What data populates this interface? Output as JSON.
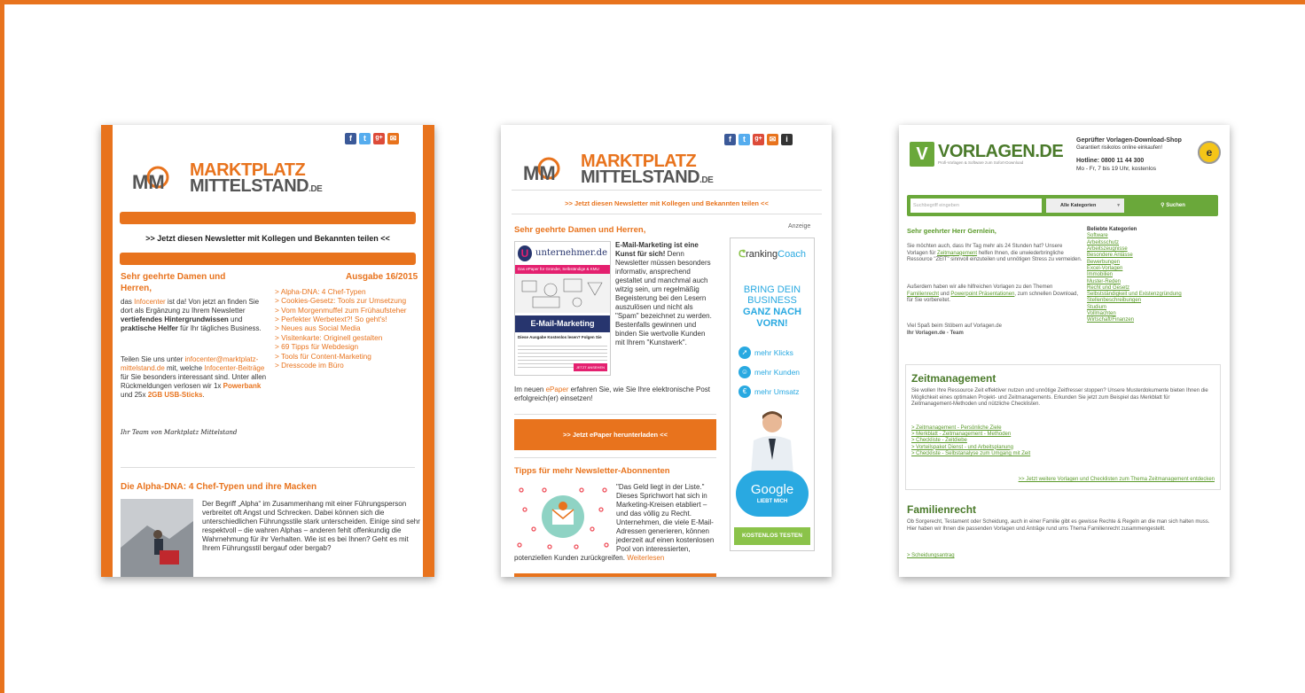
{
  "colors": {
    "accent": "#e8731d",
    "vorlagen_green": "#6aa83a",
    "facebook": "#3b5998",
    "twitter": "#55acee",
    "google": "#dd4b39",
    "mail": "#e8731d"
  },
  "card1": {
    "social_icons": [
      "facebook-icon",
      "twitter-icon",
      "googleplus-icon",
      "mail-icon"
    ],
    "logo_line1": "MARKTPLATZ",
    "logo_line2": "MITTELSTAND",
    "logo_suffix": ".DE",
    "share_text": ">> Jetzt diesen Newsletter mit Kollegen und Bekannten teilen <<",
    "greeting": "Sehr geehrte Damen und Herren,",
    "issue": "Ausgabe 16/2015",
    "intro_parts": [
      "das ",
      "Infocenter",
      " ist da! Von jetzt an finden Sie dort als Ergänzung zu Ihrem Newsletter ",
      "vertiefendes Hintergrundwissen",
      " und ",
      "praktische Helfer",
      " für Ihr tägliches Business."
    ],
    "share_parts": [
      "Teilen Sie uns unter ",
      "infocenter@marktplatz-mittelstand.de",
      " mit, welche ",
      "Infocenter-Beiträge",
      " für Sie besonders interessant sind. Unter allen Rückmeldungen verlosen wir 1x ",
      "Powerbank",
      " und 25x ",
      "2GB USB-Sticks",
      "."
    ],
    "toc": [
      "> Alpha-DNA: 4 Chef-Typen",
      "> Cookies-Gesetz: Tools zur Umsetzung",
      "> Vom Morgenmuffel zum Frühaufsteher",
      "> Perfekter Werbetext?! So geht's!",
      "> Neues aus Social Media",
      "> Visitenkarte: Originell gestalten",
      "> 69 Tipps für Webdesign",
      "> Tools für Content-Marketing",
      "> Dresscode im Büro"
    ],
    "signature": "Ihr Team von Marktplatz Mittelstand",
    "article_title": "Die Alpha-DNA: 4 Chef-Typen und ihre Macken",
    "article_text": "Der Begriff „Alpha“ im Zusammenhang mit einer Führungsperson verbreitet oft Angst und Schrecken. Dabei können sich die unterschiedlichen Führungsstile stark unterscheiden. Einige sind sehr respektvoll – die wahren Alphas – anderen fehlt offenkundig die Wahrnehmung für ihr Verhalten. Wie ist es bei Ihnen? Geht es mit Ihrem Führungsstil bergauf oder bergab?"
  },
  "card2": {
    "social_icons": [
      "facebook-icon",
      "twitter-icon",
      "googleplus-icon",
      "mail-icon",
      "info-icon"
    ],
    "share_text": ">> Jetzt diesen Newsletter mit Kollegen und Bekannten teilen <<",
    "greeting": "Sehr geehrte Damen und Herren,",
    "ad_label": "Anzeige",
    "epaper_brand": "unternehmer.de",
    "epaper_tagline": "Das ePaper für Gründer, Selbständige & KMU",
    "epaper_banner": "E-Mail-Marketing",
    "epaper_subtitle": "Diese Ausgabe Kostenlos lesen? Folgen Sie",
    "epaper_button": "JETZT ANSEHEN",
    "body_bold": "E-Mail-Marketing ist eine Kunst für sich!",
    "body_text": " Denn Newsletter müssen besonders informativ, ansprechend gestaltet und manchmal auch witzig sein, um regelmäßig Begeisterung bei den Lesern auszulösen und nicht als \"Spam\" bezeichnet zu werden. Bestenfalls gewinnen und binden Sie wertvolle Kunden mit Ihrem \"Kunstwerk\".",
    "epaper_parts": [
      "Im neuen ",
      "ePaper",
      " erfahren Sie, wie Sie Ihre elektronische Post erfolgreich(er) einsetzen!"
    ],
    "cta": ">> Jetzt ePaper herunterladen <<",
    "tips_title": "Tipps für mehr Newsletter-Abonnenten",
    "tips_text": "\"Das Geld liegt in der Liste.\" Dieses Sprichwort hat sich in Marketing-Kreisen etabliert – und das völlig zu Recht. Unternehmen, die viele E-Mail-Adressen generieren, können jederzeit auf einen kostenlosen Pool von interessierten, potenziellen Kunden zurückgreifen.",
    "read_more": "Weiterlesen",
    "ad": {
      "brand_a": "ranking",
      "brand_b": "Coach",
      "headline1": "BRING DEIN",
      "headline2": "BUSINESS",
      "headline3": "GANZ NACH",
      "headline4": "VORN!",
      "items": [
        "mehr Klicks",
        "mehr Kunden",
        "mehr Umsatz"
      ],
      "cloud_word": "Google",
      "cloud_sub": "LIEBT MICH",
      "button": "KOSTENLOS TESTEN"
    }
  },
  "card3": {
    "logo": "VORLAGEN.DE",
    "logo_sub": "Profi-Vorlagen & Software zum Sofort-Download",
    "shop_title": "Geprüfter Vorlagen-Download-Shop",
    "shop_sub": "Garantiert risikolos online einkaufen!",
    "hotline": "Hotline: 0800 11 44 300",
    "hours": "Mo - Fr, 7 bis 19 Uhr, kostenlos",
    "search_placeholder": "Suchbegriff eingeben",
    "category_select": "Alle Kategorien",
    "search_button": "Suchen",
    "greeting": "Sehr geehrter Herr Gernlein,",
    "p1_parts": [
      "Sie möchten auch, dass Ihr Tag mehr als 24 Stunden hat? Unsere Vorlagen für ",
      "Zeitmanagement",
      " helfen Ihnen, die unwiederbringliche Ressource \"ZEIT\" sinnvoll einzuteilen und unnötigen Stress zu vermeiden."
    ],
    "p2_parts": [
      "Außerdem haben wir alle hilfreichen Vorlagen zu den Themen ",
      "Familienrecht",
      " und ",
      "Powerpoint Präsentationen",
      ", zum schnellen Download, für Sie vorbereitet."
    ],
    "p3": "Viel Spaß beim Stöbern auf Vorlagen.de",
    "p3_sign": "Ihr Vorlagen.de - Team",
    "popular_title": "Beliebte Kategorien",
    "popular": [
      "Software",
      "Arbeitsschutz",
      "Arbeitszeugnisse",
      "Besondere Anlässe",
      "Bewerbungen",
      "Excel-Vorlagen",
      "Immobilien",
      "Muster-Reden",
      "Recht und Gesetz",
      "Selbstständigkeit und Existenzgründung",
      "Stellenbeschreibungen",
      "Studium",
      "Vollmachten",
      "Wirtschaft/Finanzen"
    ],
    "zm_title": "Zeitmanagement",
    "zm_text": "Sie wollen Ihre Ressource Zeit effektiver nutzen und unnötige Zeitfresser stoppen? Unsere Musterdokumente bieten Ihnen die Möglichkeit eines optimalen Projekt- und Zeitmanagements. Erkunden Sie jetzt zum Beispiel das Merkblatt für Zeitmanagement-Methoden und nützliche Checklisten.",
    "zm_links": [
      "> Zeitmanagement - Persönliche Ziele",
      "> Merkblatt - Zeitmanagement - Methoden",
      "> Checkliste - Zeitdiebe",
      "> Vorteilspaket Dienst - und Arbeitsplanung",
      "> Checkliste - Selbstanalyse zum Umgang mit Zeit"
    ],
    "zm_more": ">> Jetzt weitere Vorlagen und Checklisten zum Thema Zeitmanagement entdecken",
    "fr_title": "Familienrecht",
    "fr_text": "Ob Sorgerecht, Testament oder Scheidung, auch in einer Familie gibt es gewisse Rechte & Regeln an die man sich halten muss. Hier haben wir Ihnen die passenden Vorlagen und Anträge rund ums Thema Familienrecht zusammengestellt.",
    "fr_link": "> Scheidungsantrag"
  }
}
